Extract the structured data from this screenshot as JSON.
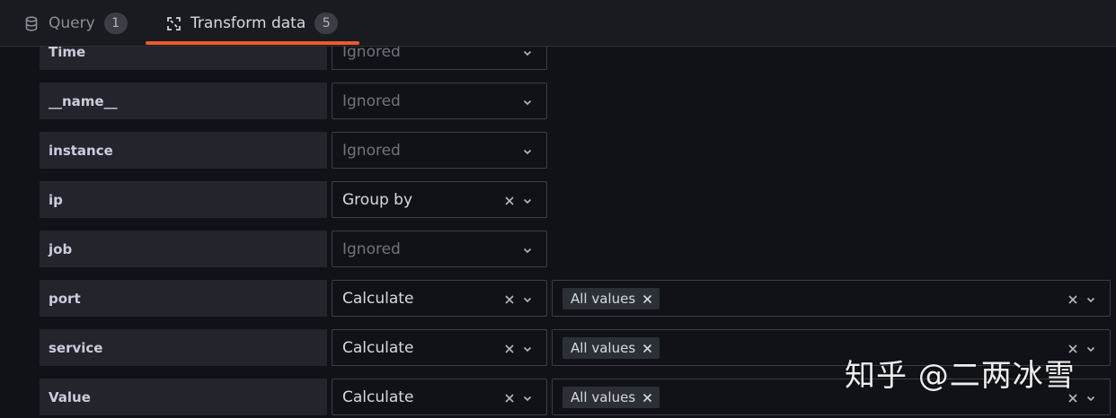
{
  "tabs": [
    {
      "label": "Query",
      "count": "1",
      "icon": "database-icon"
    },
    {
      "label": "Transform data",
      "count": "5",
      "icon": "transform-icon"
    }
  ],
  "rows": [
    {
      "field": "Time",
      "mode": "Ignored",
      "clearable": false,
      "calculation": null
    },
    {
      "field": "__name__",
      "mode": "Ignored",
      "clearable": false,
      "calculation": null
    },
    {
      "field": "instance",
      "mode": "Ignored",
      "clearable": false,
      "calculation": null
    },
    {
      "field": "ip",
      "mode": "Group by",
      "clearable": true,
      "calculation": null
    },
    {
      "field": "job",
      "mode": "Ignored",
      "clearable": false,
      "calculation": null
    },
    {
      "field": "port",
      "mode": "Calculate",
      "clearable": true,
      "calculation": "All values"
    },
    {
      "field": "service",
      "mode": "Calculate",
      "clearable": true,
      "calculation": "All values"
    },
    {
      "field": "Value",
      "mode": "Calculate",
      "clearable": true,
      "calculation": "All values"
    }
  ],
  "watermark": "知乎 @二两冰雪",
  "colors": {
    "accent": "#f05a28",
    "background": "#111217",
    "panel": "#181b1f",
    "field_bg": "#22252b"
  }
}
